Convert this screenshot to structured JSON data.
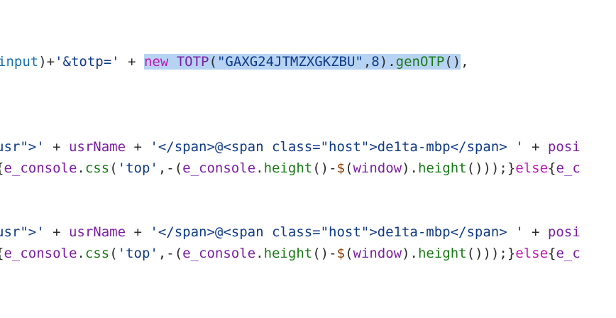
{
  "colors": {
    "background": "#ffffff",
    "selection": "#b7d3f3",
    "plain": "#2b2b2b",
    "string": "#0f3a86",
    "identifier": "#7a1fa2",
    "keyword": "#c016b5",
    "property": "#1b7a17",
    "type": "#1a6fb3",
    "dollar": "#8a3b00"
  },
  "code_lines": [
    {
      "tokens": [
        {
          "text": "input",
          "color": "#1a6fb3"
        },
        {
          "text": ")+",
          "color": "#2b2b2b"
        },
        {
          "text": "'&totp='",
          "color": "#0f3a86"
        },
        {
          "text": " + ",
          "color": "#2b2b2b"
        },
        {
          "text": "new",
          "color": "#c016b5",
          "selected": true
        },
        {
          "text": " ",
          "color": "#2b2b2b",
          "selected": true
        },
        {
          "text": "TOTP",
          "color": "#7a1fa2",
          "selected": true
        },
        {
          "text": "(",
          "color": "#2b2b2b",
          "selected": true
        },
        {
          "text": "\"GAXG24JTMZXGKZBU\"",
          "color": "#0f3a86",
          "selected": true
        },
        {
          "text": ",",
          "color": "#2b2b2b",
          "selected": true
        },
        {
          "text": "8",
          "color": "#0f3a86",
          "selected": true
        },
        {
          "text": ").",
          "color": "#2b2b2b",
          "selected": true
        },
        {
          "text": "genOTP",
          "color": "#1b7a17",
          "selected": true
        },
        {
          "text": "()",
          "color": "#2b2b2b",
          "selected": true
        },
        {
          "text": ",",
          "color": "#2b2b2b"
        }
      ]
    },
    {
      "tokens": [
        {
          "text": "usr\">'",
          "color": "#0f3a86"
        },
        {
          "text": " + ",
          "color": "#2b2b2b"
        },
        {
          "text": "usrName",
          "color": "#7a1fa2"
        },
        {
          "text": " + ",
          "color": "#2b2b2b"
        },
        {
          "text": "'</span>@<span class=\"host\">de1ta-mbp</span> '",
          "color": "#0f3a86"
        },
        {
          "text": " + ",
          "color": "#2b2b2b"
        },
        {
          "text": "posi",
          "color": "#7a1fa2"
        }
      ]
    },
    {
      "tokens": [
        {
          "text": "{",
          "color": "#2b2b2b"
        },
        {
          "text": "e_console",
          "color": "#7a1fa2"
        },
        {
          "text": ".",
          "color": "#2b2b2b"
        },
        {
          "text": "css",
          "color": "#1b7a17"
        },
        {
          "text": "(",
          "color": "#2b2b2b"
        },
        {
          "text": "'top'",
          "color": "#0f3a86"
        },
        {
          "text": ",-(",
          "color": "#2b2b2b"
        },
        {
          "text": "e_console",
          "color": "#7a1fa2"
        },
        {
          "text": ".",
          "color": "#2b2b2b"
        },
        {
          "text": "height",
          "color": "#1b7a17"
        },
        {
          "text": "()-",
          "color": "#2b2b2b"
        },
        {
          "text": "$",
          "color": "#8a3b00"
        },
        {
          "text": "(",
          "color": "#2b2b2b"
        },
        {
          "text": "window",
          "color": "#7a1fa2"
        },
        {
          "text": ").",
          "color": "#2b2b2b"
        },
        {
          "text": "height",
          "color": "#1b7a17"
        },
        {
          "text": "()));}",
          "color": "#2b2b2b"
        },
        {
          "text": "else",
          "color": "#c016b5"
        },
        {
          "text": "{",
          "color": "#2b2b2b"
        },
        {
          "text": "e_c",
          "color": "#7a1fa2"
        }
      ]
    },
    {
      "tokens": [
        {
          "text": "usr\">'",
          "color": "#0f3a86"
        },
        {
          "text": " + ",
          "color": "#2b2b2b"
        },
        {
          "text": "usrName",
          "color": "#7a1fa2"
        },
        {
          "text": " + ",
          "color": "#2b2b2b"
        },
        {
          "text": "'</span>@<span class=\"host\">de1ta-mbp</span> '",
          "color": "#0f3a86"
        },
        {
          "text": " + ",
          "color": "#2b2b2b"
        },
        {
          "text": "posi",
          "color": "#7a1fa2"
        }
      ]
    },
    {
      "tokens": [
        {
          "text": "{",
          "color": "#2b2b2b"
        },
        {
          "text": "e_console",
          "color": "#7a1fa2"
        },
        {
          "text": ".",
          "color": "#2b2b2b"
        },
        {
          "text": "css",
          "color": "#1b7a17"
        },
        {
          "text": "(",
          "color": "#2b2b2b"
        },
        {
          "text": "'top'",
          "color": "#0f3a86"
        },
        {
          "text": ",-(",
          "color": "#2b2b2b"
        },
        {
          "text": "e_console",
          "color": "#7a1fa2"
        },
        {
          "text": ".",
          "color": "#2b2b2b"
        },
        {
          "text": "height",
          "color": "#1b7a17"
        },
        {
          "text": "()-",
          "color": "#2b2b2b"
        },
        {
          "text": "$",
          "color": "#8a3b00"
        },
        {
          "text": "(",
          "color": "#2b2b2b"
        },
        {
          "text": "window",
          "color": "#7a1fa2"
        },
        {
          "text": ").",
          "color": "#2b2b2b"
        },
        {
          "text": "height",
          "color": "#1b7a17"
        },
        {
          "text": "()));}",
          "color": "#2b2b2b"
        },
        {
          "text": "else",
          "color": "#c016b5"
        },
        {
          "text": "{",
          "color": "#2b2b2b"
        },
        {
          "text": "e_c",
          "color": "#7a1fa2"
        }
      ]
    }
  ]
}
